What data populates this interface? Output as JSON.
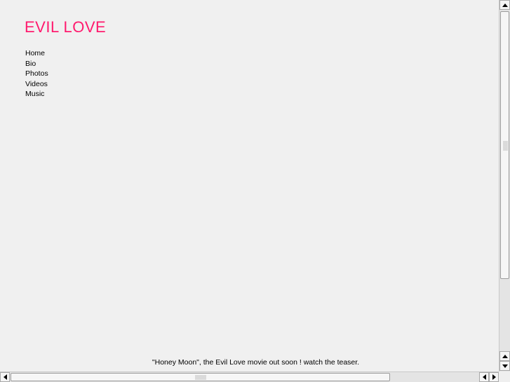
{
  "site": {
    "title": "EVIL LOVE",
    "title_color": "#ff1a6e"
  },
  "nav": {
    "items": [
      {
        "label": "Home"
      },
      {
        "label": "Bio"
      },
      {
        "label": "Photos"
      },
      {
        "label": "Videos"
      },
      {
        "label": "Music"
      }
    ]
  },
  "footer": {
    "text": "\"Honey Moon\", the Evil Love movie out soon ! watch the teaser."
  },
  "icons": {
    "scroll_up": "arrow-up-icon",
    "scroll_down": "arrow-down-icon",
    "scroll_left": "arrow-left-icon",
    "scroll_right": "arrow-right-icon"
  }
}
